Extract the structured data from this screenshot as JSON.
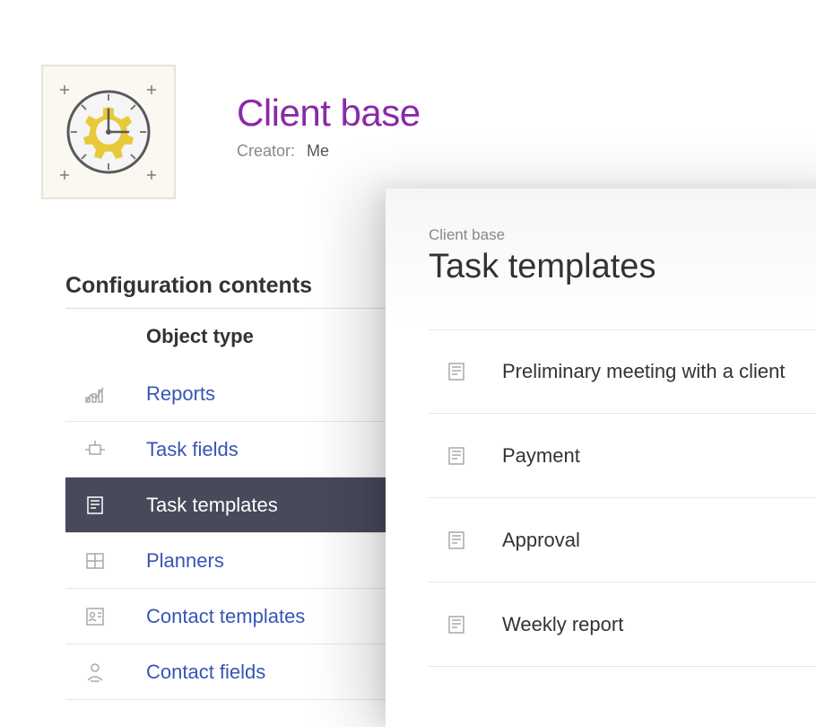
{
  "header": {
    "title": "Client base",
    "creator_label": "Creator:",
    "creator_value": "Me"
  },
  "section_title": "Configuration contents",
  "column_header": "Object type",
  "nav_items": [
    {
      "label": "Reports",
      "icon": "chart-icon"
    },
    {
      "label": "Task fields",
      "icon": "task-field-icon"
    },
    {
      "label": "Task templates",
      "icon": "template-icon",
      "active": true
    },
    {
      "label": "Planners",
      "icon": "grid-icon"
    },
    {
      "label": "Contact templates",
      "icon": "contact-template-icon"
    },
    {
      "label": "Contact fields",
      "icon": "contact-field-icon"
    }
  ],
  "overlay": {
    "breadcrumb": "Client base",
    "title": "Task templates",
    "templates": [
      {
        "label": "Preliminary meeting with a client"
      },
      {
        "label": "Payment"
      },
      {
        "label": "Approval"
      },
      {
        "label": "Weekly report"
      }
    ]
  }
}
